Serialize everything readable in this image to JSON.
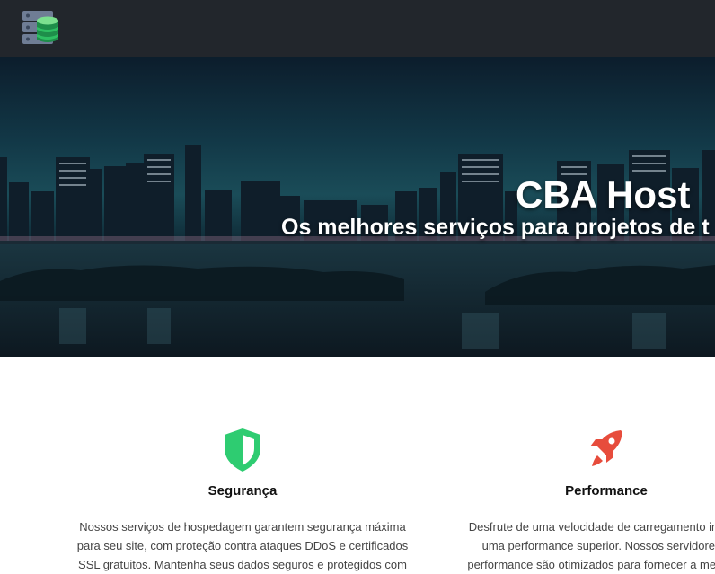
{
  "header": {
    "logo_icon": "server-database-icon"
  },
  "hero": {
    "title": "CBA Host",
    "subtitle": "Os melhores serviços para projetos de t"
  },
  "features": [
    {
      "icon": "shield-icon",
      "title": "Segurança",
      "lines": [
        "Nossos serviços de hospedagem garantem segurança máxima",
        "para seu site, com proteção contra ataques DDoS e certificados",
        "SSL gratuitos. Mantenha seus dados seguros e protegidos com"
      ],
      "color": "#2ecc71"
    },
    {
      "icon": "rocket-icon",
      "title": "Performance",
      "lines": [
        "Desfrute de uma velocidade de carregamento impres",
        "uma performance superior. Nossos servidores d",
        "performance são otimizados para fornecer a melhor e"
      ],
      "color": "#e74c3c"
    }
  ]
}
